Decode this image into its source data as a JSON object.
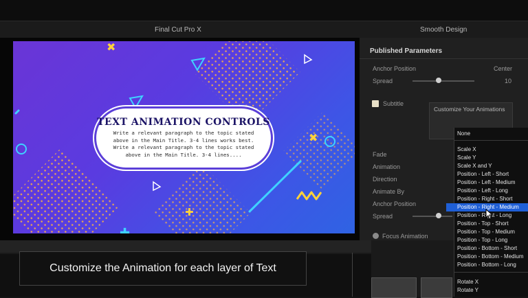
{
  "window": {
    "app_title": "Final Cut Pro X",
    "panel_title": "Smooth Design"
  },
  "canvas": {
    "title": "TEXT ANIMATION CONTROLS",
    "body": "Write a relevant paragraph to the topic stated above in the Main Title. 3-4 lines works best. Write a relevant paragraph to the topic stated above in the Main Title. 3-4 lines....",
    "colors": {
      "bg_start": "#6a35d6",
      "bg_end": "#2f63e3",
      "accent_yellow": "#ffd23a",
      "accent_cyan": "#3fd2ff"
    }
  },
  "inspector": {
    "header": "Published Parameters",
    "anchor_position": {
      "label": "Anchor Position",
      "value": "Center"
    },
    "spread": {
      "label": "Spread",
      "value": "10"
    },
    "subtitle": {
      "label": "Subtitle",
      "checked": true
    },
    "params": [
      "Fade",
      "Animation",
      "Direction",
      "Animate By",
      "Anchor Position",
      "Spread"
    ],
    "focus_animation": "Focus Animation",
    "tooltip": "Customize Your Animations"
  },
  "menu": {
    "items": [
      "None",
      "Scale X",
      "Scale Y",
      "Scale X and Y",
      "Position - Left - Short",
      "Position - Left - Medium",
      "Position - Left - Long",
      "Position - Right - Short",
      "Position - Right - Medium",
      "Position - Right - Long",
      "Position - Top - Short",
      "Position - Top - Medium",
      "Position - Top - Long",
      "Position - Bottom - Short",
      "Position - Bottom - Medium",
      "Position - Bottom - Long",
      "Rotate X",
      "Rotate Y"
    ],
    "selected": "Position - Right - Medium"
  },
  "caption": "Customize the Animation for each layer of Text"
}
